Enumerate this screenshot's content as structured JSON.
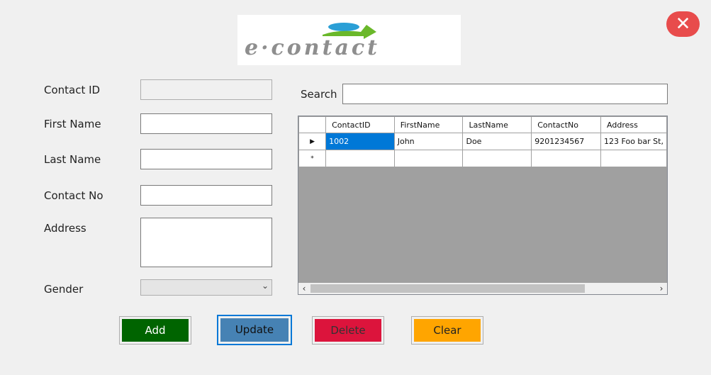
{
  "header": {
    "logo_text": "e·contact",
    "close_glyph": "✕"
  },
  "form": {
    "contact_id_label": "Contact ID",
    "first_name_label": "First Name",
    "last_name_label": "Last Name",
    "contact_no_label": "Contact No",
    "address_label": "Address",
    "gender_label": "Gender",
    "contact_id_value": "",
    "first_name_value": "",
    "last_name_value": "",
    "contact_no_value": "",
    "address_value": "",
    "gender_value": ""
  },
  "search": {
    "label": "Search",
    "value": ""
  },
  "grid": {
    "columns": [
      "ContactID",
      "FirstName",
      "LastName",
      "ContactNo",
      "Address"
    ],
    "rows": [
      {
        "marker": "▶",
        "cells": [
          "1002",
          "John",
          "Doe",
          "9201234567",
          "123 Foo bar St,"
        ]
      },
      {
        "marker": "*",
        "cells": [
          "",
          "",
          "",
          "",
          ""
        ]
      }
    ]
  },
  "buttons": {
    "add": "Add",
    "update": "Update",
    "delete": "Delete",
    "clear": "Clear"
  },
  "colors": {
    "add": "#006400",
    "update": "#4682b4",
    "delete": "#dc143c",
    "clear": "#ffa500",
    "close": "#e84c4c",
    "selection": "#0078d7"
  }
}
